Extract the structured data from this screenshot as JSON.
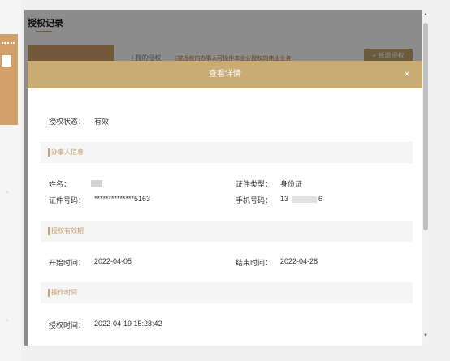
{
  "background": {
    "page_title": "授权记录",
    "tab_label": "| 我的授权",
    "tip_text": "(被授权的办事人可操作本企业授权的商业业务)",
    "add_button": "+ 新增授权"
  },
  "modal": {
    "title": "查看详情",
    "close_icon": "×",
    "status": {
      "label": "授权状态：",
      "value": "有效"
    },
    "sections": {
      "agent_info": "办事人信息",
      "validity": "授权有效期",
      "operation_time": "操作时间"
    },
    "agent": {
      "name_label": "姓名：",
      "id_type_label": "证件类型：",
      "id_type_value": "身份证",
      "id_no_label": "证件号码：",
      "id_no_value": "**************5163",
      "phone_label": "手机号码：",
      "phone_prefix": "13",
      "phone_suffix": "6"
    },
    "validity": {
      "start_label": "开始时间：",
      "start_value": "2022-04-05",
      "end_label": "结束时间：",
      "end_value": "2022-04-28"
    },
    "operation": {
      "auth_time_label": "授权时间：",
      "auth_time_value": "2022-04-19 15:28:42"
    }
  },
  "colors": {
    "accent": "#c9ac74",
    "section_text": "#c09a6a",
    "tan": "#d2a06a"
  }
}
